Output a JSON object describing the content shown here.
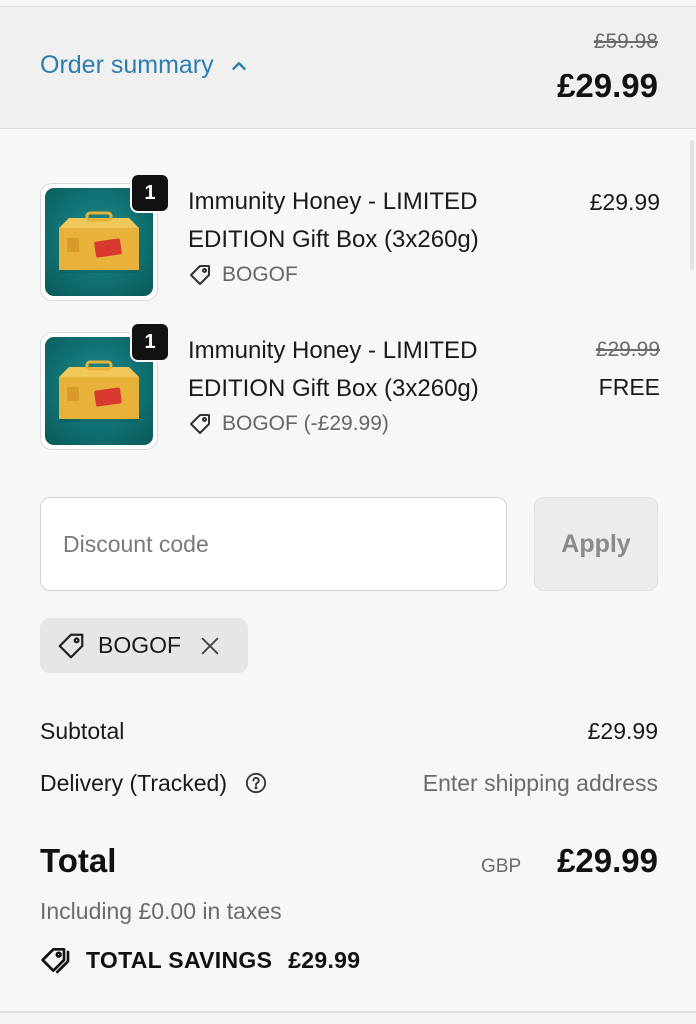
{
  "summary": {
    "toggle_label": "Order summary",
    "original_total": "£59.98",
    "total": "£29.99"
  },
  "items": [
    {
      "quantity": "1",
      "title": "Immunity Honey - LIMITED EDITION Gift Box (3x260g)",
      "discount_tag": "BOGOF",
      "price": "£29.99",
      "original_price": "",
      "final_price": ""
    },
    {
      "quantity": "1",
      "title": "Immunity Honey - LIMITED EDITION Gift Box (3x260g)",
      "discount_tag": "BOGOF (-£29.99)",
      "price": "",
      "original_price": "£29.99",
      "final_price": "FREE"
    }
  ],
  "discount": {
    "placeholder": "Discount code",
    "apply_label": "Apply",
    "applied_code": "BOGOF"
  },
  "totals": {
    "subtotal_label": "Subtotal",
    "subtotal_value": "£29.99",
    "delivery_label": "Delivery (Tracked)",
    "delivery_value": "Enter shipping address",
    "total_label": "Total",
    "currency": "GBP",
    "total_value": "£29.99",
    "taxes_note": "Including £0.00 in taxes",
    "savings_label": "TOTAL SAVINGS",
    "savings_value": "£29.99"
  },
  "colors": {
    "link": "#2a7fb0",
    "thumbnail_bg": "#0f6e6f",
    "gift_box": "#e8b23a"
  }
}
